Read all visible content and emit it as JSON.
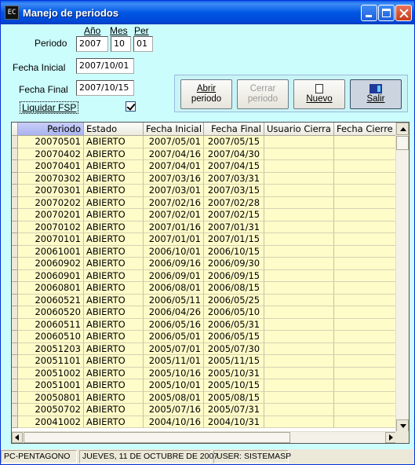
{
  "window": {
    "title": "Manejo de periodos",
    "app_icon": "EC"
  },
  "form": {
    "periodo_label": "Periodo",
    "col_ano": "Año",
    "col_mes": "Mes",
    "col_per": "Per",
    "ano": "2007",
    "mes": "10",
    "per": "01",
    "fecha_inicial_label": "Fecha Inicial",
    "fecha_inicial": "2007/10/01",
    "fecha_final_label": "Fecha Final",
    "fecha_final": "2007/10/15",
    "liquidar_label": "Liquidar FSP",
    "liquidar_checked": true
  },
  "buttons": {
    "abrir_1": "Abrir",
    "abrir_2": "periodo",
    "cerrar_1": "Cerrar",
    "cerrar_2": "periodo",
    "nuevo": "Nuevo",
    "salir": "Salir"
  },
  "grid": {
    "columns": [
      "Periodo",
      "Estado",
      "Fecha Inicial",
      "Fecha Final",
      "Usuario Cierra",
      "Fecha Cierre"
    ],
    "rows": [
      [
        "20070501",
        "ABIERTO",
        "2007/05/01",
        "2007/05/15",
        "",
        ""
      ],
      [
        "20070402",
        "ABIERTO",
        "2007/04/16",
        "2007/04/30",
        "",
        ""
      ],
      [
        "20070401",
        "ABIERTO",
        "2007/04/01",
        "2007/04/15",
        "",
        ""
      ],
      [
        "20070302",
        "ABIERTO",
        "2007/03/16",
        "2007/03/31",
        "",
        ""
      ],
      [
        "20070301",
        "ABIERTO",
        "2007/03/01",
        "2007/03/15",
        "",
        ""
      ],
      [
        "20070202",
        "ABIERTO",
        "2007/02/16",
        "2007/02/28",
        "",
        ""
      ],
      [
        "20070201",
        "ABIERTO",
        "2007/02/01",
        "2007/02/15",
        "",
        ""
      ],
      [
        "20070102",
        "ABIERTO",
        "2007/01/16",
        "2007/01/31",
        "",
        ""
      ],
      [
        "20070101",
        "ABIERTO",
        "2007/01/01",
        "2007/01/15",
        "",
        ""
      ],
      [
        "20061001",
        "ABIERTO",
        "2006/10/01",
        "2006/10/15",
        "",
        ""
      ],
      [
        "20060902",
        "ABIERTO",
        "2006/09/16",
        "2006/09/30",
        "",
        ""
      ],
      [
        "20060901",
        "ABIERTO",
        "2006/09/01",
        "2006/09/15",
        "",
        ""
      ],
      [
        "20060801",
        "ABIERTO",
        "2006/08/01",
        "2006/08/15",
        "",
        ""
      ],
      [
        "20060521",
        "ABIERTO",
        "2006/05/11",
        "2006/05/25",
        "",
        ""
      ],
      [
        "20060520",
        "ABIERTO",
        "2006/04/26",
        "2006/05/10",
        "",
        ""
      ],
      [
        "20060511",
        "ABIERTO",
        "2006/05/16",
        "2006/05/31",
        "",
        ""
      ],
      [
        "20060510",
        "ABIERTO",
        "2006/05/01",
        "2006/05/15",
        "",
        ""
      ],
      [
        "20051203",
        "ABIERTO",
        "2005/07/01",
        "2005/07/30",
        "",
        ""
      ],
      [
        "20051101",
        "ABIERTO",
        "2005/11/01",
        "2005/11/15",
        "",
        ""
      ],
      [
        "20051002",
        "ABIERTO",
        "2005/10/16",
        "2005/10/31",
        "",
        ""
      ],
      [
        "20051001",
        "ABIERTO",
        "2005/10/01",
        "2005/10/15",
        "",
        ""
      ],
      [
        "20050801",
        "ABIERTO",
        "2005/08/01",
        "2005/08/15",
        "",
        ""
      ],
      [
        "20050702",
        "ABIERTO",
        "2005/07/16",
        "2005/07/31",
        "",
        ""
      ],
      [
        "20041002",
        "ABIERTO",
        "2004/10/16",
        "2004/10/31",
        "",
        ""
      ]
    ]
  },
  "status": {
    "computer": "PC-PENTAGONO",
    "date": "JUEVES, 11 DE OCTUBRE DE 2007",
    "user": "USER: SISTEMASP"
  }
}
